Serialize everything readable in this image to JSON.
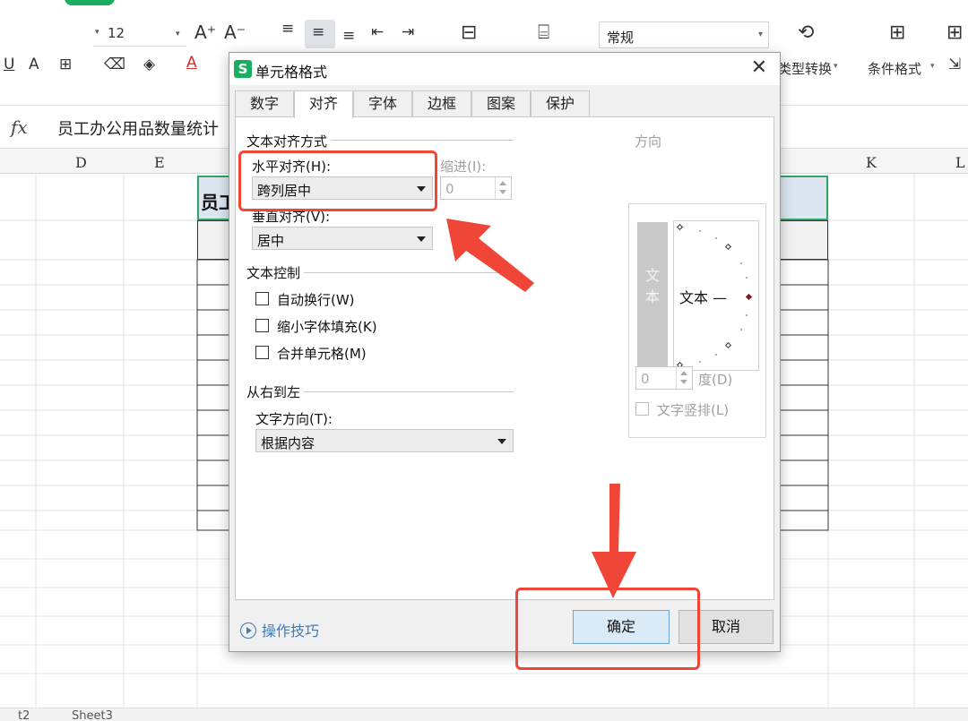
{
  "ribbon": {
    "font_size": "12",
    "grow_font": "A⁺",
    "shrink_font": "A⁻",
    "number_format": "常规",
    "type_convert_label": "类型转换",
    "conditional_format_label": "条件格式"
  },
  "formula_bar": {
    "fx_label": "fx",
    "content": "员工办公用品数量统计"
  },
  "sheet": {
    "columns": [
      "D",
      "E",
      "K",
      "L"
    ],
    "title_cell_text": "员工",
    "sheet_tab_1": "t2",
    "sheet_tab_2": "Sheet3"
  },
  "dialog": {
    "logo": "S",
    "title": "单元格格式",
    "tabs": [
      "数字",
      "对齐",
      "字体",
      "边框",
      "图案",
      "保护"
    ],
    "active_tab": "对齐",
    "text_alignment_group": "文本对齐方式",
    "horizontal_label": "水平对齐(H):",
    "horizontal_value": "跨列居中",
    "indent_label": "缩进(I):",
    "indent_value": "0",
    "vertical_label": "垂直对齐(V):",
    "vertical_value": "居中",
    "text_control_group": "文本控制",
    "wrap_text": "自动换行(W)",
    "shrink_to_fit": "缩小字体填充(K)",
    "merge_cells": "合并单元格(M)",
    "rtl_group": "从右到左",
    "text_direction_label": "文字方向(T):",
    "text_direction_value": "根据内容",
    "orientation_group": "方向",
    "vertical_text_chars": [
      "文",
      "本"
    ],
    "dial_text": "文本 —",
    "degree_value": "0",
    "degree_label": "度(D)",
    "vertical_text_checkbox": "文字竖排(L)",
    "tips_link": "操作技巧",
    "ok_button": "确定",
    "cancel_button": "取消"
  },
  "colors": {
    "accent_green": "#1aad5e",
    "annotation_red": "#f04638",
    "link_blue": "#3b7bbf",
    "title_fill": "#dce6f1"
  }
}
